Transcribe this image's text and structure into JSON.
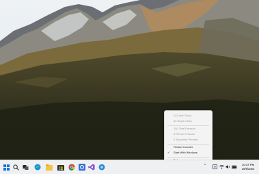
{
  "context_menu": {
    "items": [
      {
        "label": "123 Left Clicks",
        "enabled": false,
        "checked": false
      },
      {
        "label": "84 Right Clicks",
        "enabled": false,
        "checked": false
      },
      {
        "label": "150 Total Presses",
        "enabled": false,
        "checked": false
      },
      {
        "label": "8 Return Presses",
        "enabled": false,
        "checked": false
      },
      {
        "label": "2 Spacebar Presses",
        "enabled": false,
        "checked": false
      },
      {
        "label": "Restart Counter",
        "enabled": true,
        "checked": false
      },
      {
        "label": "Start With Windows",
        "enabled": true,
        "checked": true
      },
      {
        "label": "Exit",
        "enabled": true,
        "checked": false
      }
    ]
  },
  "taskbar": {
    "apps": [
      "windows-start",
      "search",
      "task-view",
      "edge",
      "file-explorer",
      "microsoft-store",
      "chrome",
      "settings",
      "visual-studio",
      "mouse-counter"
    ],
    "tray_chevron": "^",
    "clock": {
      "time": "10:37 PM",
      "date": "10/6/2022"
    }
  },
  "colors": {
    "menu_bg": "#f3f3f3",
    "taskbar_bg": "#eef0f2",
    "disabled_text": "#9a9a9a"
  }
}
